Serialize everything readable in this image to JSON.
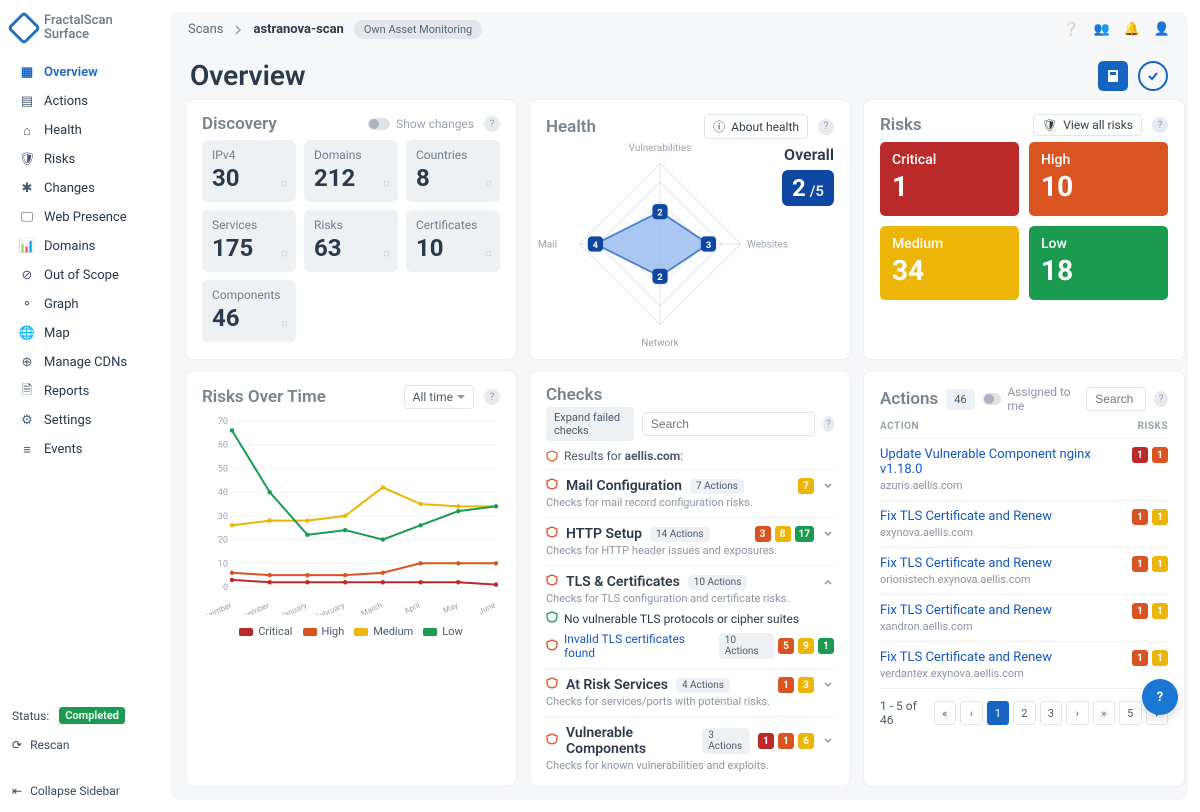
{
  "brand": {
    "line1": "FractalScan",
    "line2": "Surface"
  },
  "nav": [
    {
      "icon": "grid",
      "label": "Overview",
      "active": true
    },
    {
      "icon": "list",
      "label": "Actions"
    },
    {
      "icon": "home",
      "label": "Health"
    },
    {
      "icon": "shield",
      "label": "Risks"
    },
    {
      "icon": "spark",
      "label": "Changes"
    },
    {
      "icon": "monitor",
      "label": "Web Presence"
    },
    {
      "icon": "bars",
      "label": "Domains"
    },
    {
      "icon": "ban",
      "label": "Out of Scope"
    },
    {
      "icon": "share",
      "label": "Graph"
    },
    {
      "icon": "globe",
      "label": "Map"
    },
    {
      "icon": "net",
      "label": "Manage CDNs"
    },
    {
      "icon": "file",
      "label": "Reports"
    },
    {
      "icon": "cog",
      "label": "Settings"
    },
    {
      "icon": "stream",
      "label": "Events"
    }
  ],
  "status": {
    "label": "Status:",
    "value": "Completed",
    "rescan": "Rescan",
    "collapse": "Collapse Sidebar"
  },
  "crumbs": {
    "root": "Scans",
    "scan": "astranova-scan",
    "chip": "Own Asset Monitoring"
  },
  "page": {
    "title": "Overview"
  },
  "discovery": {
    "title": "Discovery",
    "show_changes": "Show changes",
    "tiles": [
      {
        "label": "IPv4",
        "value": "30",
        "icon": "id"
      },
      {
        "label": "Domains",
        "value": "212",
        "icon": "sitemap"
      },
      {
        "label": "Countries",
        "value": "8",
        "icon": "globe"
      },
      {
        "label": "Services",
        "value": "175",
        "icon": "download"
      },
      {
        "label": "Risks",
        "value": "63",
        "icon": "shield"
      },
      {
        "label": "Certificates",
        "value": "10",
        "icon": "cert"
      },
      {
        "label": "Components",
        "value": "46",
        "icon": "plug"
      }
    ]
  },
  "health": {
    "title": "Health",
    "about": "About health",
    "overall_label": "Overall",
    "overall_num": "2",
    "overall_den": "/5",
    "axes": {
      "top": "Vulnerabilities",
      "right": "Websites",
      "bottom": "Network",
      "left": "Mail"
    },
    "markers": [
      "2",
      "3",
      "2",
      "4"
    ]
  },
  "risks_panel": {
    "title": "Risks",
    "view_all": "View all risks",
    "tiles": [
      {
        "label": "Critical",
        "value": "1",
        "cls": "r-critical"
      },
      {
        "label": "High",
        "value": "10",
        "cls": "r-high"
      },
      {
        "label": "Medium",
        "value": "34",
        "cls": "r-medium"
      },
      {
        "label": "Low",
        "value": "18",
        "cls": "r-low"
      }
    ]
  },
  "risks_over_time": {
    "title": "Risks Over Time",
    "range": "All time",
    "legend": {
      "critical": "Critical",
      "high": "High",
      "medium": "Medium",
      "low": "Low"
    }
  },
  "chart_data": {
    "type": "line",
    "x": [
      "November",
      "December",
      "January",
      "February",
      "March",
      "April",
      "May",
      "June"
    ],
    "xlabel": "",
    "ylabel": "",
    "ylim": [
      0,
      70
    ],
    "yticks": [
      0,
      10,
      20,
      30,
      40,
      50,
      60,
      70
    ],
    "series": [
      {
        "name": "Critical",
        "color": "#bb2a2a",
        "values": [
          3,
          2,
          2,
          2,
          2,
          2,
          2,
          1
        ]
      },
      {
        "name": "High",
        "color": "#d95420",
        "values": [
          6,
          5,
          5,
          5,
          6,
          10,
          10,
          10
        ]
      },
      {
        "name": "Medium",
        "color": "#ecb507",
        "values": [
          26,
          28,
          28,
          30,
          42,
          35,
          34,
          34
        ]
      },
      {
        "name": "Low",
        "color": "#1a9b50",
        "values": [
          66,
          40,
          22,
          24,
          20,
          26,
          32,
          34
        ]
      }
    ]
  },
  "checks": {
    "title": "Checks",
    "expand": "Expand failed checks",
    "search_placeholder": "Search",
    "results_for": "Results for",
    "domain": "aellis.com",
    "items": [
      {
        "title": "Mail Configuration",
        "actions": "7 Actions",
        "desc": "Checks for mail record configuration risks.",
        "pills": [
          {
            "n": "7",
            "cls": "pn-yellow"
          }
        ],
        "expanded": false
      },
      {
        "title": "HTTP Setup",
        "actions": "14 Actions",
        "desc": "Checks for HTTP header issues and exposures.",
        "pills": [
          {
            "n": "3",
            "cls": "pn-orange"
          },
          {
            "n": "8",
            "cls": "pn-yellow"
          },
          {
            "n": "17",
            "cls": "pn-green"
          }
        ],
        "expanded": false
      },
      {
        "title": "TLS & Certificates",
        "actions": "10 Actions",
        "desc": "Checks for TLS configuration and certificate risks.",
        "pills": [],
        "expanded": true,
        "sub": [
          {
            "ok": true,
            "text": "No vulnerable TLS protocols or cipher suites"
          },
          {
            "ok": false,
            "text": "Invalid TLS certificates found",
            "actions": "10 Actions",
            "pills": [
              {
                "n": "5",
                "cls": "pn-orange"
              },
              {
                "n": "9",
                "cls": "pn-yellow"
              },
              {
                "n": "1",
                "cls": "pn-green"
              }
            ]
          }
        ]
      },
      {
        "title": "At Risk Services",
        "actions": "4 Actions",
        "desc": "Checks for services/ports with potential risks.",
        "pills": [
          {
            "n": "1",
            "cls": "pn-orange"
          },
          {
            "n": "3",
            "cls": "pn-yellow"
          }
        ],
        "expanded": false
      },
      {
        "title": "Vulnerable Components",
        "actions": "3 Actions",
        "desc": "Checks for known vulnerabilities and exploits.",
        "pills": [
          {
            "n": "1",
            "cls": "pn-red"
          },
          {
            "n": "1",
            "cls": "pn-orange"
          },
          {
            "n": "6",
            "cls": "pn-yellow"
          }
        ],
        "expanded": false
      }
    ]
  },
  "actions": {
    "title": "Actions",
    "count": "46",
    "assigned": "Assigned to me",
    "search_placeholder": "Search",
    "cols": {
      "action": "ACTION",
      "risks": "RISKS"
    },
    "rows": [
      {
        "title": "Update Vulnerable Component nginx v1.18.0",
        "host": "azuris.aellis.com",
        "pills": [
          {
            "n": "1",
            "cls": "pn-red"
          },
          {
            "n": "1",
            "cls": "pn-orange"
          }
        ]
      },
      {
        "title": "Fix TLS Certificate and Renew",
        "host": "exynova.aellis.com",
        "pills": [
          {
            "n": "1",
            "cls": "pn-orange"
          },
          {
            "n": "1",
            "cls": "pn-yellow"
          }
        ]
      },
      {
        "title": "Fix TLS Certificate and Renew",
        "host": "orionistech.exynova.aellis.com",
        "pills": [
          {
            "n": "1",
            "cls": "pn-orange"
          },
          {
            "n": "1",
            "cls": "pn-yellow"
          }
        ]
      },
      {
        "title": "Fix TLS Certificate and Renew",
        "host": "xandron.aellis.com",
        "pills": [
          {
            "n": "1",
            "cls": "pn-orange"
          },
          {
            "n": "1",
            "cls": "pn-yellow"
          }
        ]
      },
      {
        "title": "Fix TLS Certificate and Renew",
        "host": "verdantex.exynova.aellis.com",
        "pills": [
          {
            "n": "1",
            "cls": "pn-orange"
          },
          {
            "n": "1",
            "cls": "pn-yellow"
          }
        ]
      }
    ],
    "range": "1 - 5 of 46",
    "pages": [
      "1",
      "2",
      "3"
    ],
    "pages_last": "5"
  }
}
